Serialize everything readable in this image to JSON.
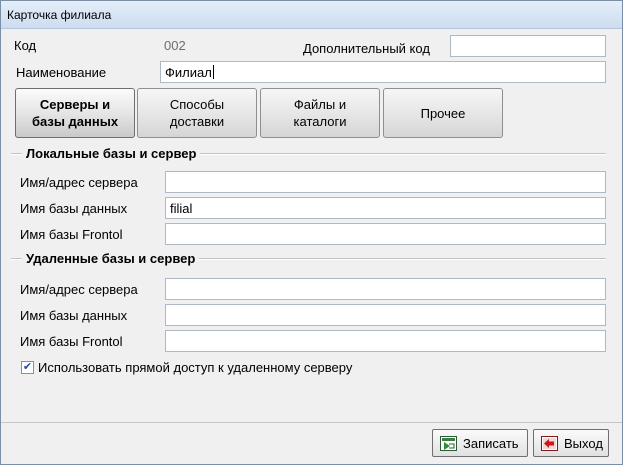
{
  "window": {
    "title": "Карточка филиала"
  },
  "code": {
    "label": "Код",
    "value": "002"
  },
  "extra_code": {
    "label": "Дополнительный код",
    "value": ""
  },
  "name": {
    "label": "Наименование",
    "value": "Филиал"
  },
  "tabs": [
    {
      "label": "Серверы и базы данных",
      "active": true
    },
    {
      "label": "Способы доставки",
      "active": false
    },
    {
      "label": "Файлы и каталоги",
      "active": false
    },
    {
      "label": "Прочее",
      "active": false
    }
  ],
  "local": {
    "title": "Локальные базы и сервер",
    "server": {
      "label": "Имя/адрес сервера",
      "value": ""
    },
    "db": {
      "label": "Имя базы данных",
      "value": "filial"
    },
    "frontol": {
      "label": "Имя базы Frontol",
      "value": ""
    }
  },
  "remote": {
    "title": "Удаленные  базы и сервер",
    "server": {
      "label": "Имя/адрес сервера",
      "value": ""
    },
    "db": {
      "label": "Имя базы данных",
      "value": ""
    },
    "frontol": {
      "label": "Имя базы Frontol",
      "value": ""
    }
  },
  "direct_access": {
    "label": "Использовать прямой доступ к удаленному серверу",
    "checked": true
  },
  "buttons": {
    "save": {
      "label": "Записать",
      "icon": "save-icon"
    },
    "exit": {
      "label": "Выход",
      "icon": "exit-icon"
    }
  },
  "colors": {
    "accent_green": "#2f8a3a",
    "exit_red": "#c8171e",
    "check_blue": "#1b4fa0"
  }
}
